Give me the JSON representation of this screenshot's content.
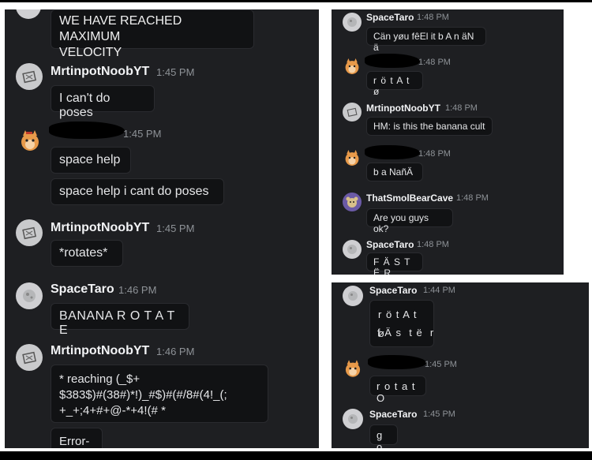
{
  "panel_left": {
    "messages": [
      {
        "text": "WE HAVE REACHED MAXIMUM\nVELOCITY"
      },
      {
        "user": "MrtinpotNoobYT",
        "time": "1:45 PM",
        "text": "I can't do poses"
      },
      {
        "time": "1:45 PM",
        "texts": [
          "space help",
          "space help i cant do poses"
        ]
      },
      {
        "user": "MrtinpotNoobYT",
        "time": "1:45 PM",
        "text": "*rotates*"
      },
      {
        "user": "SpaceTaro",
        "time": "1:46 PM",
        "text": "BANANA R O T A T E"
      },
      {
        "user": "MrtinpotNoobYT",
        "time": "1:46 PM",
        "text": "* reaching (_$+\n$383$)#(38#)*!)_#$)#(#/8#(4!_(;\n+_+;4+#+@-*+4!(# *",
        "text2": "Error-"
      }
    ]
  },
  "panel_top_right": {
    "messages": [
      {
        "user": "SpaceTaro",
        "time": "1:48 PM",
        "text": "Cän yøu fêEl it b A n äN ä"
      },
      {
        "time": "1:48 PM",
        "text": "r ö t A t ø"
      },
      {
        "user": "MrtinpotNoobYT",
        "time": "1:48 PM",
        "text": "HM: is this the banana cult"
      },
      {
        "time": "1:48 PM",
        "text": "b a NañÄ"
      },
      {
        "user": "ThatSmolBearCave",
        "time": "1:48 PM",
        "text": "Are you guys ok?"
      },
      {
        "user": "SpaceTaro",
        "time": "1:48 PM",
        "text": "F Ä S T Ë R"
      }
    ]
  },
  "panel_bottom_right": {
    "messages": [
      {
        "user": "SpaceTaro",
        "time": "1:44 PM",
        "texts": [
          "r ö t A t ø",
          "f Ä s  t ë  r"
        ]
      },
      {
        "time": "1:45 PM",
        "text": "r o t a t O"
      },
      {
        "user": "SpaceTaro",
        "time": "1:45 PM",
        "text": "g o"
      }
    ]
  },
  "colors": {
    "panel_bg": "#1e1f22",
    "bubble_bg": "#111214",
    "username": "#f2f3f5",
    "timestamp": "#8e9297"
  },
  "icons": [
    "space-avatar-icon",
    "mrtinpot-avatar-icon",
    "cat-avatar-icon",
    "bear-avatar-icon"
  ]
}
